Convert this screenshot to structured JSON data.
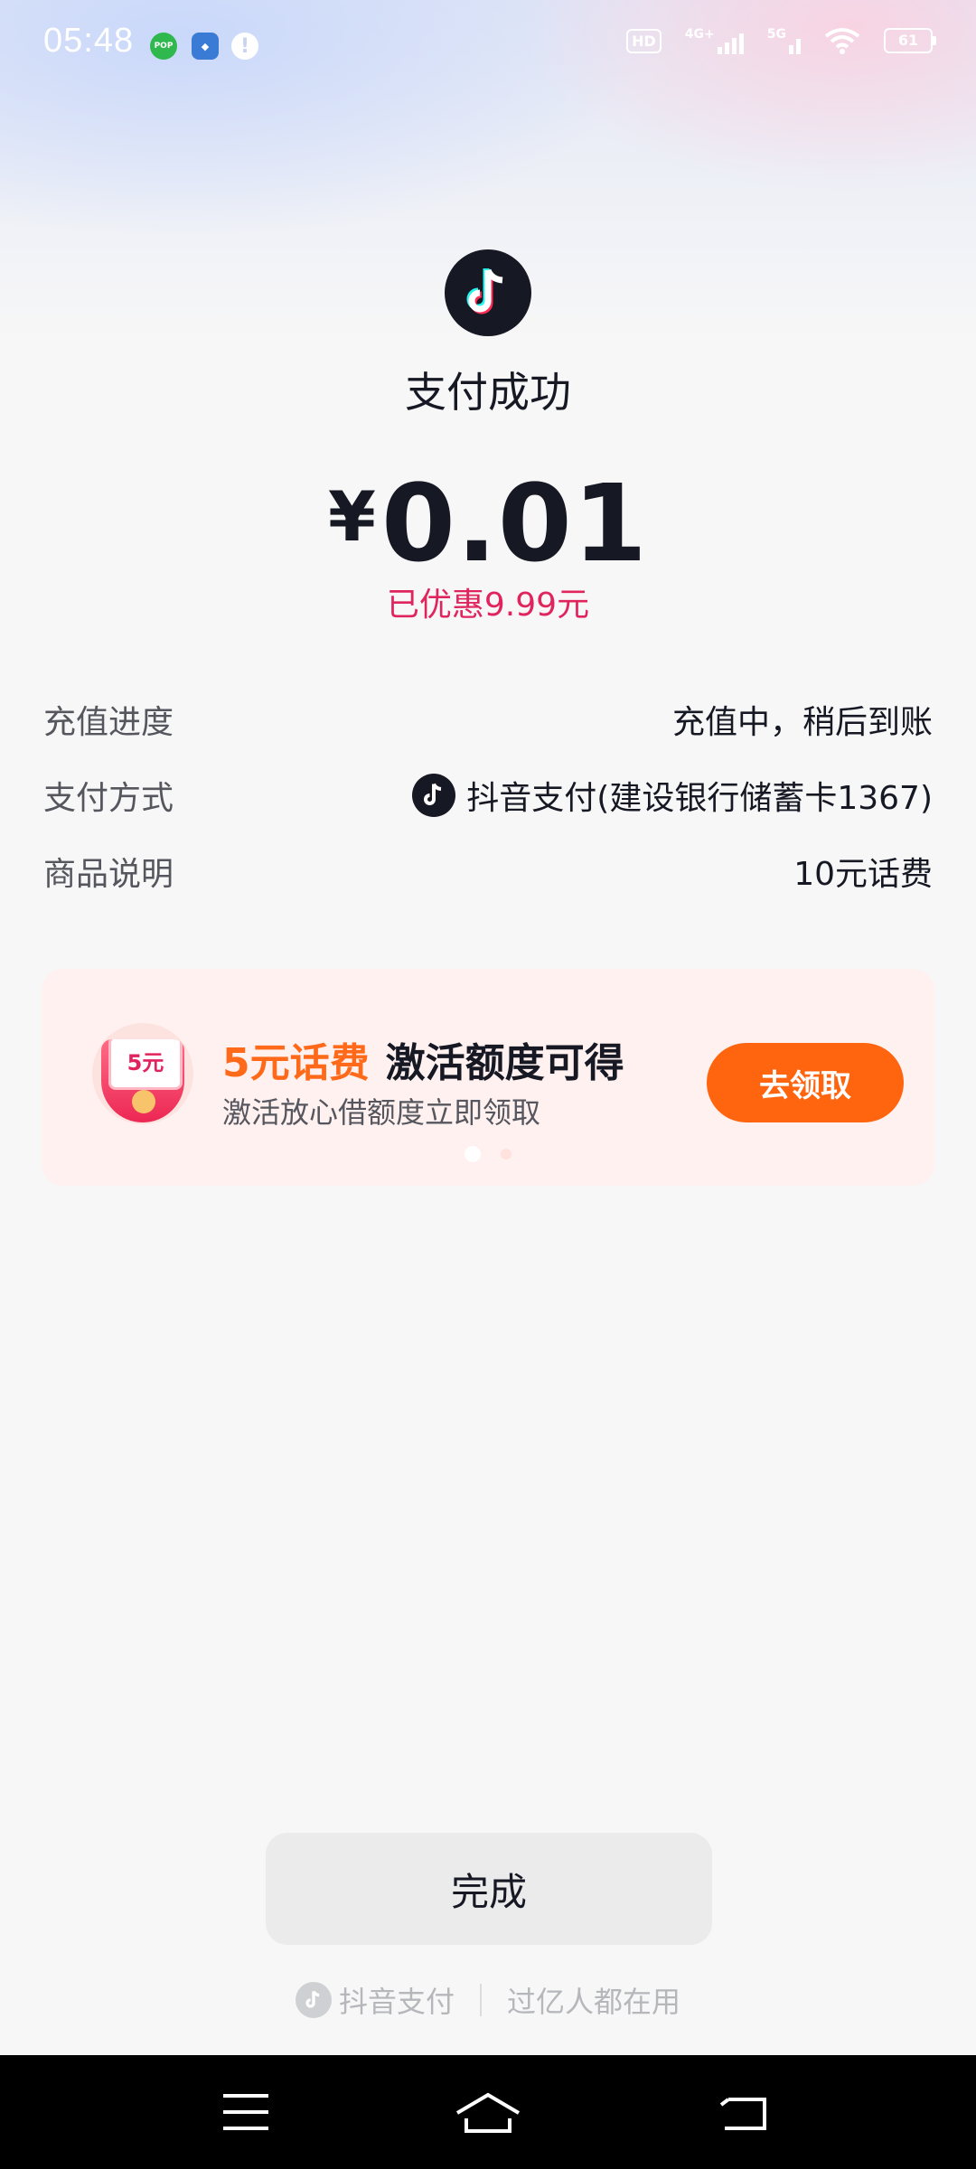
{
  "status_bar": {
    "time": "05:48",
    "left_icons": [
      "pop-app-icon",
      "app-store-icon",
      "alert-icon"
    ],
    "green_icon_text": "POP",
    "hd_label": "HD",
    "network_labels": [
      "4G+",
      "5G"
    ],
    "battery": "61"
  },
  "header": {
    "title": "支付成功",
    "currency": "¥",
    "amount": "0.01",
    "discount": "已优惠9.99元"
  },
  "details": [
    {
      "label": "充值进度",
      "value": "充值中，稍后到账"
    },
    {
      "label": "支付方式",
      "value": "抖音支付(建设银行储蓄卡1367)"
    },
    {
      "label": "商品说明",
      "value": "10元话费"
    }
  ],
  "promo": {
    "badge_text": "5元",
    "title_highlight": "5元话费",
    "title_rest": "激活额度可得",
    "subtitle": "激活放心借额度立即领取",
    "button": "去领取",
    "page_index": 1,
    "page_count": 2
  },
  "done_button": "完成",
  "footer": {
    "brand": "抖音支付",
    "slogan": "过亿人都在用"
  },
  "colors": {
    "accent_red": "#e0245e",
    "promo_orange": "#ff640f",
    "text_primary": "#161823"
  }
}
